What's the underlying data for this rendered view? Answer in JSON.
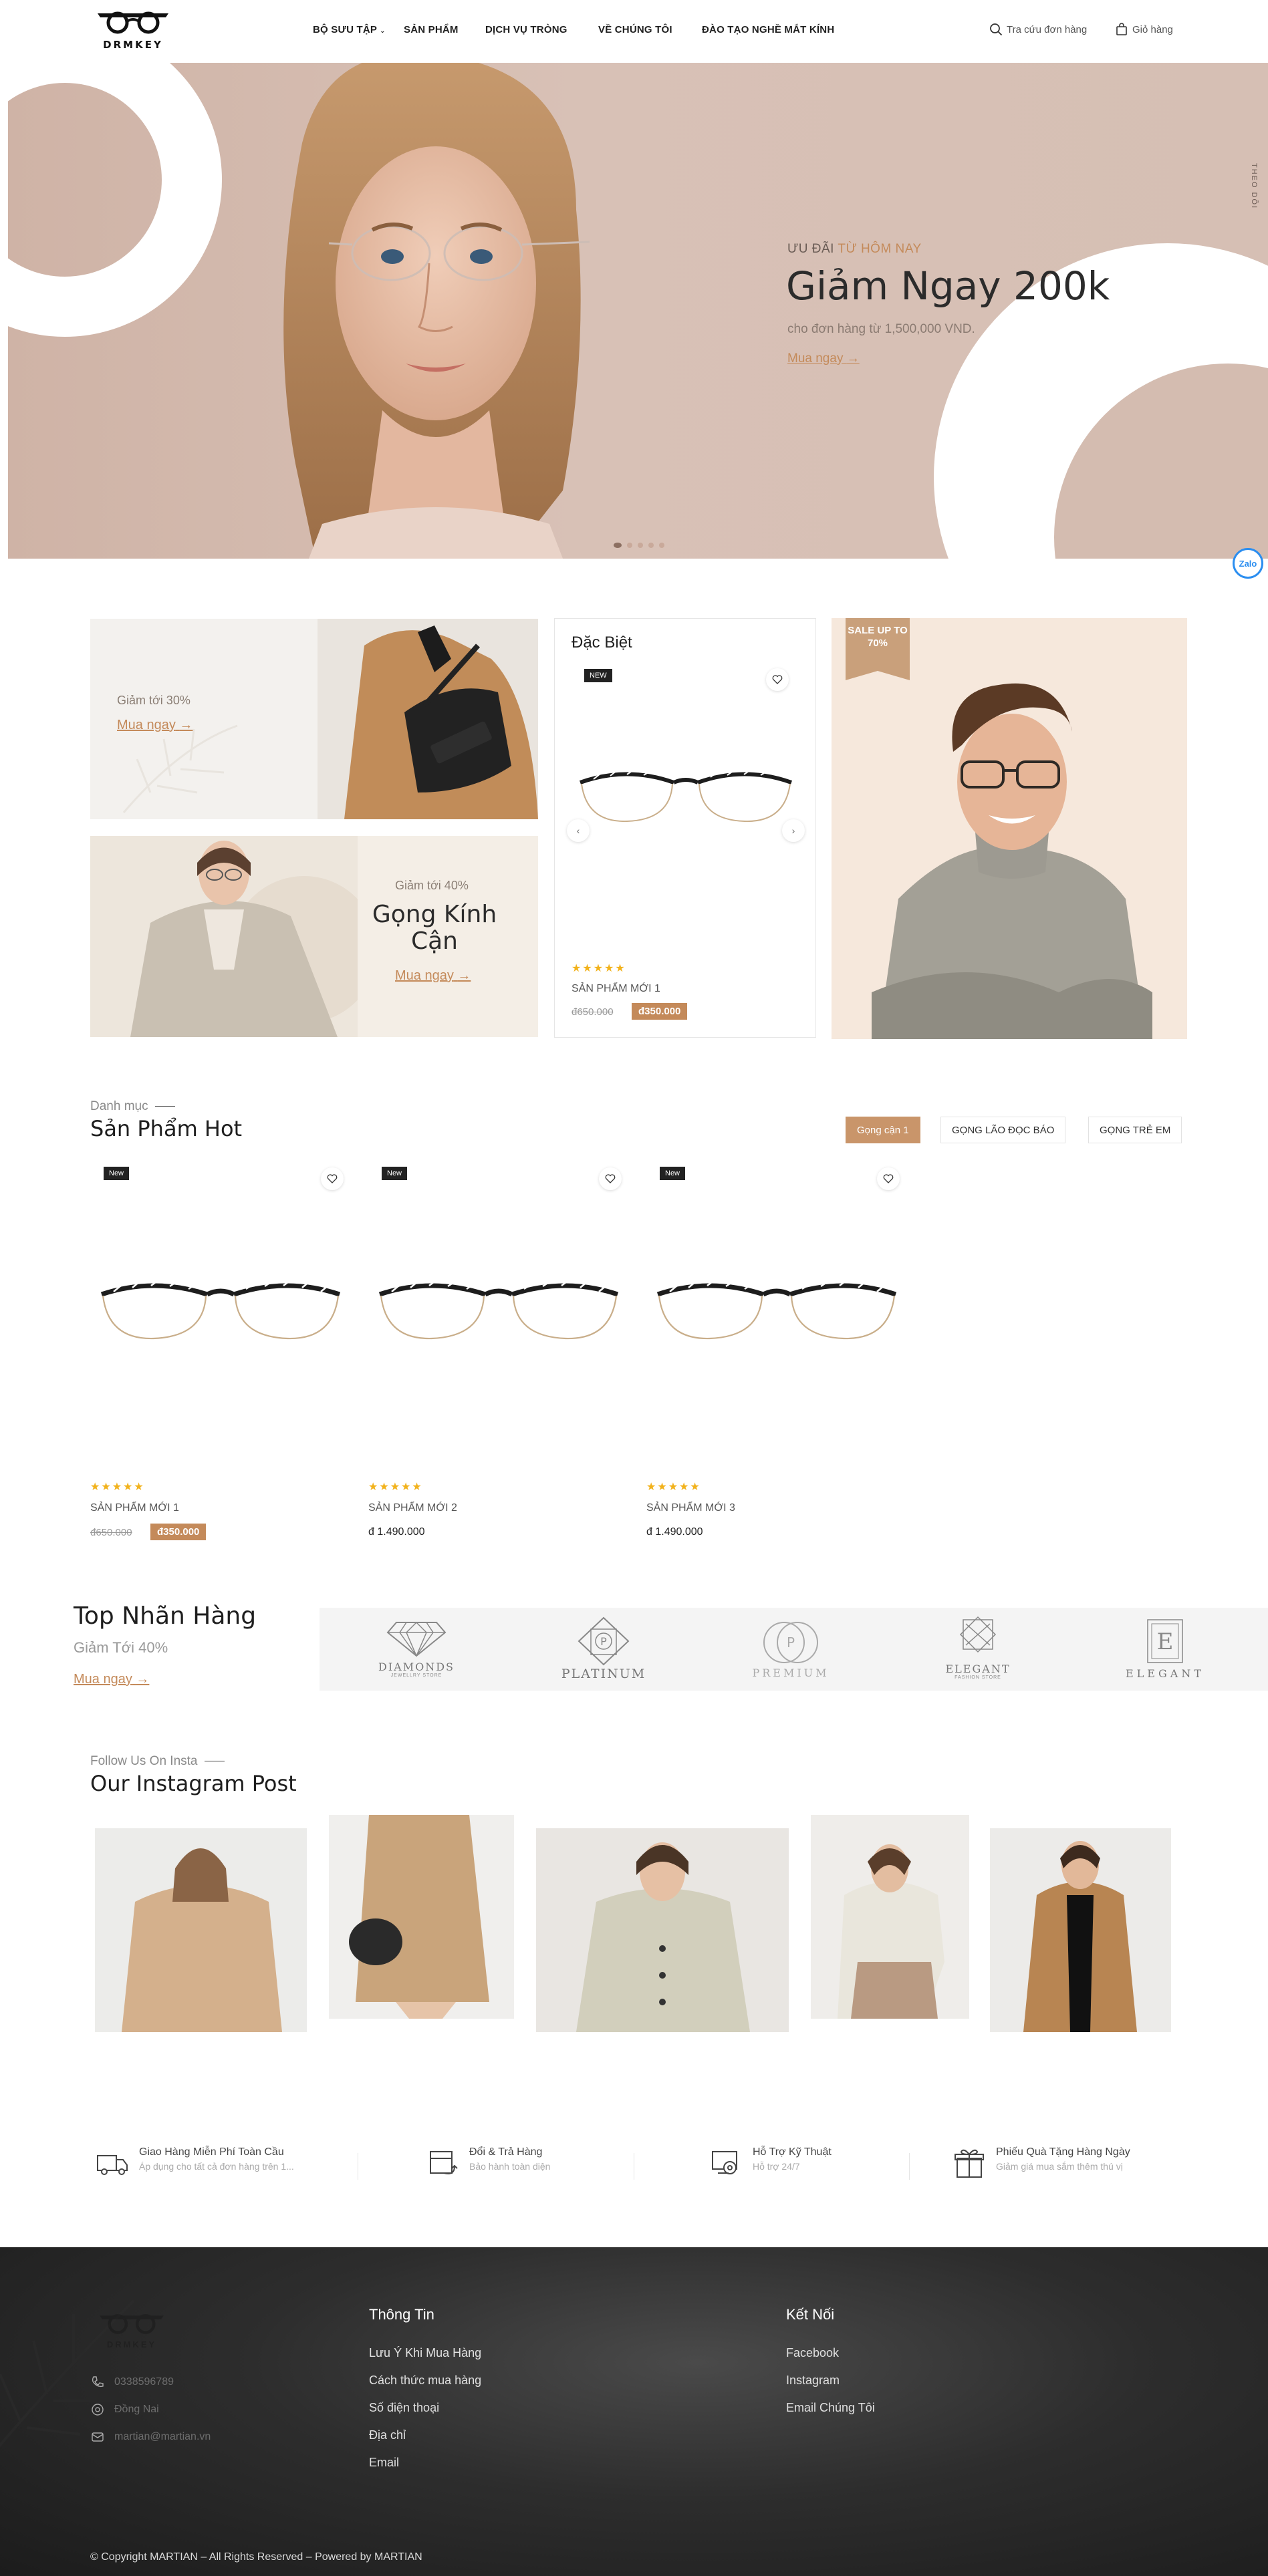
{
  "header": {
    "logo_text": "DRMKEY",
    "nav": [
      {
        "label": "BỘ SƯU TẬP"
      },
      {
        "label": "SẢN PHẨM"
      },
      {
        "label": "DỊCH VỤ TRÒNG"
      },
      {
        "label": "VỀ CHÚNG TÔI"
      },
      {
        "label": "ĐÀO TẠO NGHỀ MẮT KÍNH"
      }
    ],
    "order_lookup": "Tra cứu đơn hàng",
    "cart": "Giỏ hàng",
    "icons": [
      "search-icon",
      "bag-icon",
      "chevron-down-icon"
    ]
  },
  "hero": {
    "kicker_prefix": "ƯU ĐÃI",
    "kicker_highlight": "TỪ HÔM NAY",
    "title": "Giảm Ngay 200k",
    "desc": "cho đơn hàng từ 1,500,000 VND.",
    "cta": "Mua ngay",
    "side_text": "THEO DÕI",
    "slide_count": 5,
    "active_slide": 1,
    "colors": {
      "bg": "#d4bcb0",
      "accent": "#c48a5a"
    }
  },
  "zalo": {
    "label": "Zalo"
  },
  "promos": {
    "promo1": {
      "small": "Giảm tới 30%",
      "cta": "Mua ngay"
    },
    "promo2": {
      "small": "Giảm tới 40%",
      "title": "Gọng Kính Cận",
      "cta": "Mua ngay"
    },
    "special": {
      "title": "Đặc Biệt",
      "badge": "NEW",
      "rating": "★★★★★",
      "name": "SẢN PHẨM MỚI 1",
      "old_price": "đ650.000",
      "sale_price": "đ350.000"
    },
    "promo3": {
      "ribbon": "SALE UP TO 70%"
    }
  },
  "hot": {
    "kicker": "Danh mục",
    "title": "Sản Phẩm Hot",
    "tabs": [
      {
        "label": "Gọng cận 1",
        "active": true
      },
      {
        "label": "GỌNG LÃO ĐỌC BÁO",
        "active": false
      },
      {
        "label": "GỌNG TRẺ EM",
        "active": false
      }
    ],
    "products": [
      {
        "badge": "New",
        "rating": "★★★★★",
        "name": "SẢN PHẨM MỚI 1",
        "old_price": "đ650.000",
        "sale_price": "đ350.000"
      },
      {
        "badge": "New",
        "rating": "★★★★★",
        "name": "SẢN PHẨM MỚI 2",
        "price": "đ 1.490.000"
      },
      {
        "badge": "New",
        "rating": "★★★★★",
        "name": "SẢN PHẨM MỚI 3",
        "price": "đ 1.490.000"
      }
    ]
  },
  "brands": {
    "title": "Top Nhãn Hàng",
    "sub": "Giảm Tới 40%",
    "cta": "Mua ngay",
    "logos": [
      {
        "name": "DIAMONDS",
        "tagline": "JEWELLRY STORE"
      },
      {
        "name": "PLATINUM"
      },
      {
        "name": "PREMIUM"
      },
      {
        "name": "ELEGANT",
        "tagline": "FASHION STORE"
      },
      {
        "name": "ELEGANT"
      }
    ]
  },
  "instagram": {
    "kicker": "Follow Us On Insta",
    "title": "Our Instagram Post"
  },
  "features": [
    {
      "title": "Giao Hàng Miễn Phí Toàn Cầu",
      "desc": "Áp dụng cho tất cả đơn hàng trên 1...",
      "icon": "truck-icon"
    },
    {
      "title": "Đổi & Trả Hàng",
      "desc": "Bảo hành toàn diện",
      "icon": "return-box-icon"
    },
    {
      "title": "Hỗ Trợ Kỹ Thuật",
      "desc": "Hỗ trợ 24/7",
      "icon": "support-icon"
    },
    {
      "title": "Phiếu Quà Tặng Hàng Ngày",
      "desc": "Giảm giá mua sắm thêm thú vị",
      "icon": "gift-icon"
    }
  ],
  "footer": {
    "logo_text": "DRMKEY",
    "phone": "0338596789",
    "address": "Đồng Nai",
    "email": "martian@martian.vn",
    "info_title": "Thông Tin",
    "info_links": [
      "Lưu Ý Khi Mua Hàng",
      "Cách thức mua hàng",
      "Số điện thoại",
      "Địa chỉ",
      "Email"
    ],
    "connect_title": "Kết Nối",
    "connect_links": [
      "Facebook",
      "Instagram",
      "Email Chúng Tôi"
    ],
    "copyright": "© Copyright MARTIAN – All Rights Reserved – Powered by MARTIAN"
  }
}
